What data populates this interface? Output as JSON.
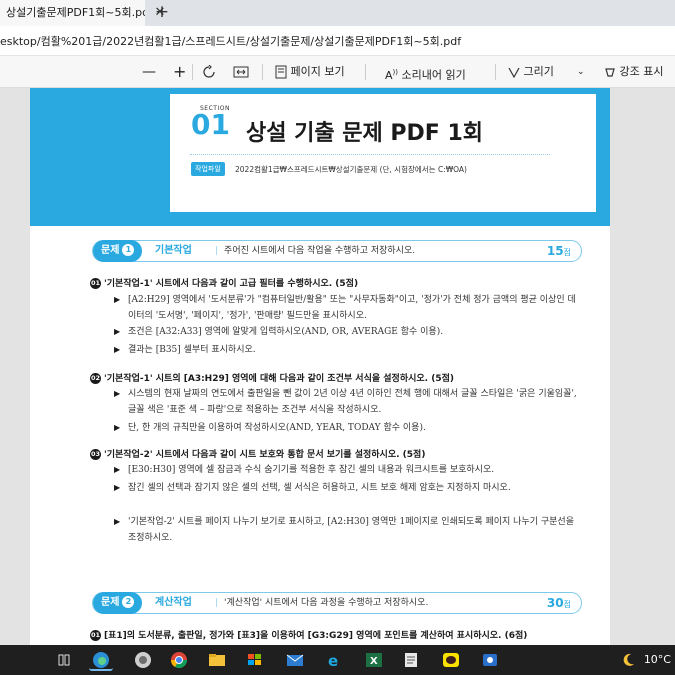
{
  "browser": {
    "tab_title": "상설기출문제PDF1회~5회.pdf",
    "tab_close": "✕",
    "new_tab": "+",
    "address": "esktop/컴활%201급/2022년컴활1급/스프레드시트/상설기출문제/상설기출문제PDF1회~5회.pdf"
  },
  "toolbar": {
    "zoom_out": "—",
    "zoom_in": "+",
    "page_view": "페이지 보기",
    "read_aloud": "소리내어 읽기",
    "draw": "그리기",
    "highlight": "강조 표시"
  },
  "doc": {
    "section_label": "SECTION",
    "section_num": "01",
    "title": "상설 기출 문제 PDF 1회",
    "file_badge": "작업파일",
    "file_path": "2022컴활1급₩스프레드시트₩상설기출문제 (단, 시험장에서는 C:₩OA)",
    "q1": {
      "tag": "문제",
      "num": "1",
      "category": "기본작업",
      "desc": "주어진 시트에서 다음 작업을 수행하고 저장하시오.",
      "score": "15",
      "score_unit": "점",
      "items": [
        {
          "num": "01",
          "heading": "'기본작업-1' 시트에서 다음과 같이 고급 필터를 수행하시오. (5점)",
          "bullets": [
            "[A2:H29] 영역에서 '도서분류'가 \"컴퓨터일반/활용\" 또는 \"사무자동화\"이고, '정가'가 전체 정가 금액의 평균 이상인 데이터의 '도서명', '페이지', '정가', '판매량' 필드만을 표시하시오.",
            "조건은 [A32:A33] 영역에 알맞게 입력하시오(AND, OR, AVERAGE 함수 이용).",
            "결과는 [B35] 셀부터 표시하시오."
          ]
        },
        {
          "num": "02",
          "heading": "'기본작업-1' 시트의 [A3:H29] 영역에 대해 다음과 같이 조건부 서식을 설정하시오. (5점)",
          "bullets": [
            "시스템의 현재 날짜의 연도에서 출판일을 뺀 값이 2년 이상 4년 이하인 전체 행에 대해서 글꼴 스타일은 '굵은 기울임꼴', 글꼴 색은 '표준 색 – 파랑'으로 적용하는 조건부 서식을 작성하시오.",
            "단, 한 개의 규칙만을 이용하여 작성하시오(AND, YEAR, TODAY 함수 이용)."
          ]
        },
        {
          "num": "03",
          "heading": "'기본작업-2' 시트에서 다음과 같이 시트 보호와 통합 문서 보기를 설정하시오. (5점)",
          "bullets": [
            "[E30:H30] 영역에 셀 잠금과 수식 숨기기를 적용한 후 잠긴 셀의 내용과 워크시트를 보호하시오.",
            "잠긴 셀의 선택과 잠기지 않은 셀의 선택, 셀 서식은 허용하고, 시트 보호 해제 암호는 지정하지 마시오.",
            "'기본작업-2' 시트를 페이지 나누기 보기로 표시하고, [A2:H30] 영역만 1페이지로 인쇄되도록 페이지 나누기 구분선을 조정하시오."
          ]
        }
      ]
    },
    "q2": {
      "tag": "문제",
      "num": "2",
      "category": "계산작업",
      "desc": "'계산작업' 시트에서 다음 과정을 수행하고 저장하시오.",
      "score": "30",
      "score_unit": "점",
      "items": [
        {
          "num": "01",
          "heading": "[표1]의 도서분류, 출판일, 정가와 [표3]을 이용하여 [G3:G29] 영역에 포인트를 계산하여 표시하시오. (6점)"
        }
      ]
    }
  },
  "taskbar": {
    "weather": "10°C"
  },
  "colors": {
    "accent": "#2aa9e0",
    "taskbar": "#1f1f1f"
  }
}
